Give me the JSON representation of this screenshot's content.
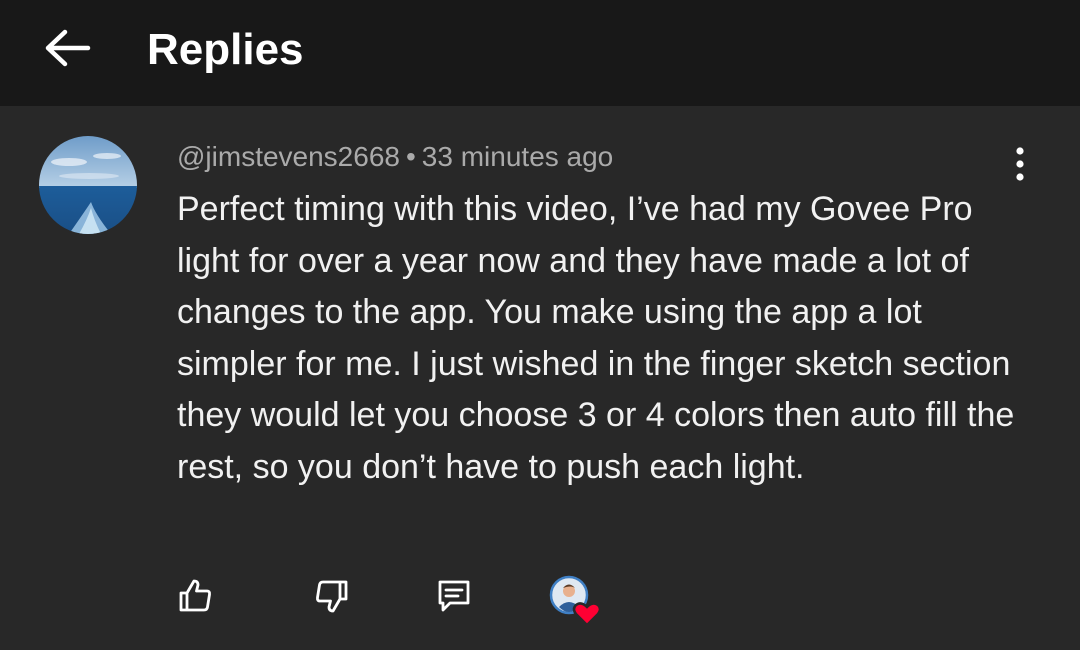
{
  "header": {
    "back_icon": "arrow-left-icon",
    "title": "Replies"
  },
  "comment": {
    "author": "@jimstevens2668",
    "separator": "•",
    "time": "33 minutes ago",
    "text": "Perfect timing with this video, I’ve had my Govee Pro light for over a year now and they have made a lot of changes to the app. You make using the app a lot simpler for me. I just wished in the finger sketch section they would let you choose 3 or 4 colors then auto fill the rest, so you don’t have to push each light.",
    "more_icon": "more-vertical-icon"
  },
  "actions": {
    "like_icon": "thumbs-up-icon",
    "dislike_icon": "thumbs-down-icon",
    "reply_icon": "reply-comment-icon",
    "creator_heart_icon": "creator-heart-icon"
  },
  "colors": {
    "header_bg": "#181818",
    "body_bg": "#282828",
    "text_primary": "#f1f1f1",
    "text_secondary": "#aaaaaa",
    "heart_red": "#ff0033"
  }
}
